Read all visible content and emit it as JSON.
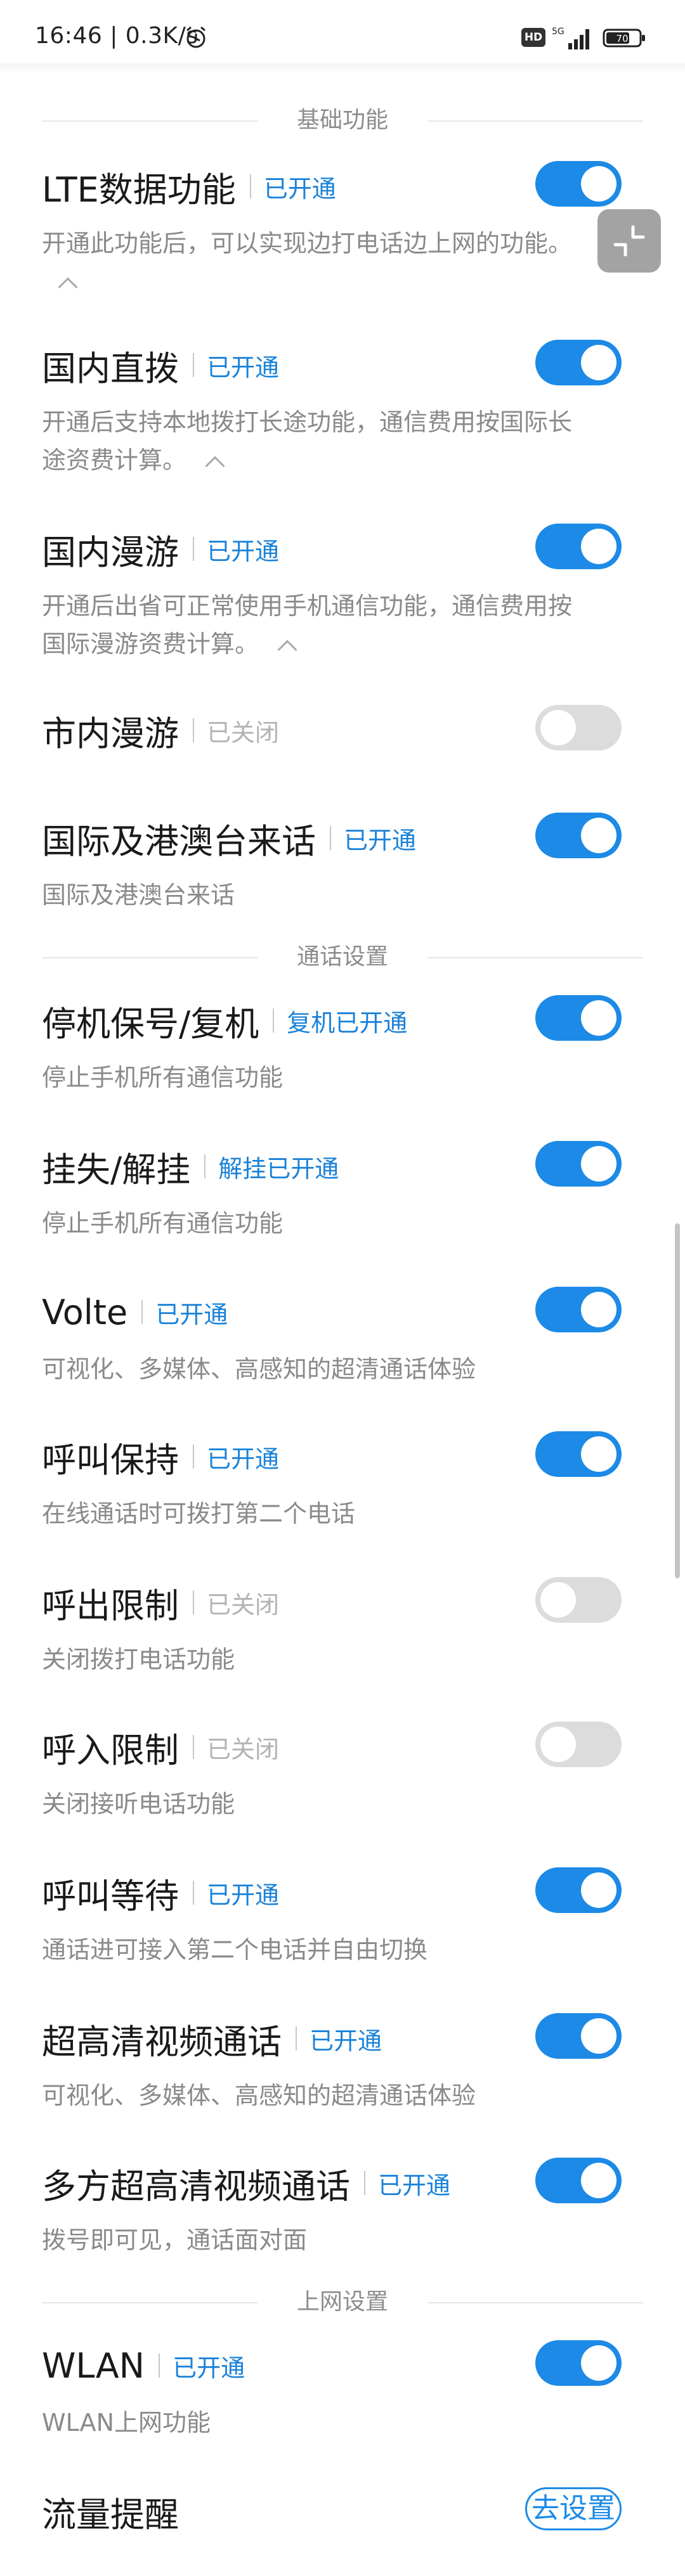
{
  "status_bar": {
    "time": "16:46 | 0.3K/s",
    "alarm_icon": "alarm-clock-icon",
    "hd_label": "HD",
    "network": "5G",
    "battery_level": "70"
  },
  "sections": [
    {
      "label": "基础功能"
    },
    {
      "label": "通话设置"
    },
    {
      "label": "上网设置"
    }
  ],
  "items": [
    {
      "title": "LTE数据功能",
      "status": "已开通",
      "enabled": true,
      "desc": "开通此功能后，可以实现边打电话边上网的功能。",
      "desc2": ""
    },
    {
      "title": "国内直拨",
      "status": "已开通",
      "enabled": true,
      "desc": "开通后支持本地拨打长途功能，通信费用按国际长",
      "desc2": "途资费计算。"
    },
    {
      "title": "国内漫游",
      "status": "已开通",
      "enabled": true,
      "desc": "开通后出省可正常使用手机通信功能，通信费用按",
      "desc2": "国际漫游资费计算。"
    },
    {
      "title": "市内漫游",
      "status": "已关闭",
      "enabled": false,
      "desc": "",
      "desc2": ""
    },
    {
      "title": "国际及港澳台来话",
      "status": "已开通",
      "enabled": true,
      "desc": "国际及港澳台来话",
      "desc2": ""
    },
    {
      "title": "停机保号/复机",
      "status": "复机已开通",
      "enabled": true,
      "desc": "停止手机所有通信功能",
      "desc2": ""
    },
    {
      "title": "挂失/解挂",
      "status": "解挂已开通",
      "enabled": true,
      "desc": "停止手机所有通信功能",
      "desc2": ""
    },
    {
      "title": "Volte",
      "status": "已开通",
      "enabled": true,
      "desc": "可视化、多媒体、高感知的超清通话体验",
      "desc2": ""
    },
    {
      "title": "呼叫保持",
      "status": "已开通",
      "enabled": true,
      "desc": "在线通话时可拨打第二个电话",
      "desc2": ""
    },
    {
      "title": "呼出限制",
      "status": "已关闭",
      "enabled": false,
      "desc": "关闭拨打电话功能",
      "desc2": ""
    },
    {
      "title": "呼入限制",
      "status": "已关闭",
      "enabled": false,
      "desc": "关闭接听电话功能",
      "desc2": ""
    },
    {
      "title": "呼叫等待",
      "status": "已开通",
      "enabled": true,
      "desc": "通话进可接入第二个电话并自由切换",
      "desc2": ""
    },
    {
      "title": "超高清视频通话",
      "status": "已开通",
      "enabled": true,
      "desc": "可视化、多媒体、高感知的超清通话体验",
      "desc2": ""
    },
    {
      "title": "多方超高清视频通话",
      "status": "已开通",
      "enabled": true,
      "desc": "拨号即可见，通话面对面",
      "desc2": ""
    },
    {
      "title": "WLAN",
      "status": "已开通",
      "enabled": true,
      "desc": "WLAN上网功能",
      "desc2": ""
    }
  ],
  "traffic_reminder": {
    "title": "流量提醒",
    "button_label": "去设置"
  },
  "colors": {
    "accent": "#1c8ae6",
    "status_on": "#1a82d9",
    "status_off": "#b3b3b3"
  }
}
